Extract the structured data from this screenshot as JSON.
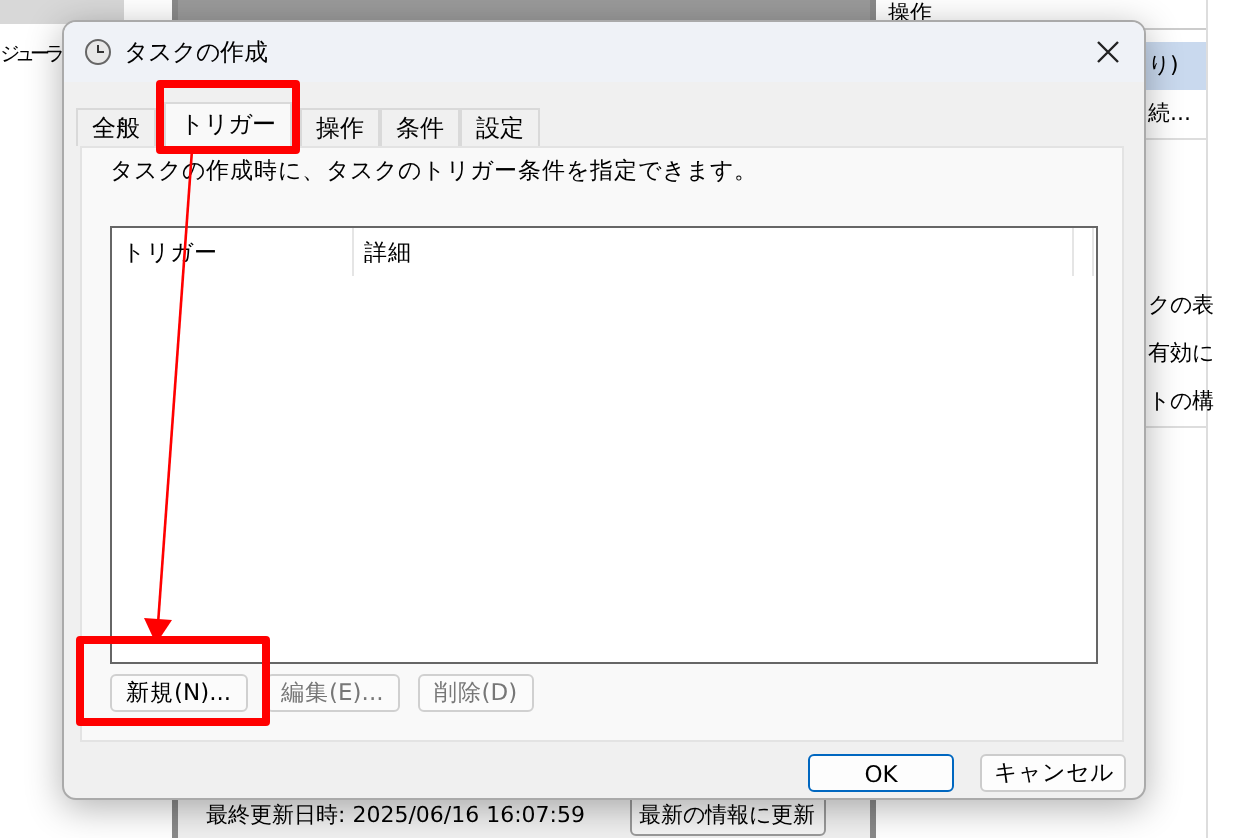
{
  "background_app": {
    "left_pane": {
      "items": [
        {
          "label": "ジューラ"
        }
      ]
    },
    "right_pane": {
      "header": "操作",
      "groups": [
        [
          {
            "label": "り)",
            "selected": true
          },
          {
            "label": "続...",
            "selected": false
          }
        ],
        [
          {
            "label": "クの表",
            "selected": false
          },
          {
            "label": "有効に",
            "selected": false
          },
          {
            "label": "トの構",
            "selected": false
          }
        ]
      ]
    },
    "status": {
      "last_updated": "最終更新日時: 2025/06/16 16:07:59",
      "refresh_button": "最新の情報に更新"
    }
  },
  "dialog": {
    "title": "タスクの作成",
    "tabs": [
      {
        "label": "全般",
        "selected": false
      },
      {
        "label": "トリガー",
        "selected": true
      },
      {
        "label": "操作",
        "selected": false
      },
      {
        "label": "条件",
        "selected": false
      },
      {
        "label": "設定",
        "selected": false
      }
    ],
    "description": "タスクの作成時に、タスクのトリガー条件を指定できます。",
    "table": {
      "columns": [
        "トリガー",
        "詳細"
      ]
    },
    "buttons": [
      {
        "label": "新規(N)...",
        "disabled": false
      },
      {
        "label": "編集(E)...",
        "disabled": true
      },
      {
        "label": "削除(D)",
        "disabled": true
      }
    ],
    "footer_buttons": [
      {
        "label": "OK",
        "default": true
      },
      {
        "label": "キャンセル",
        "default": false
      }
    ]
  }
}
